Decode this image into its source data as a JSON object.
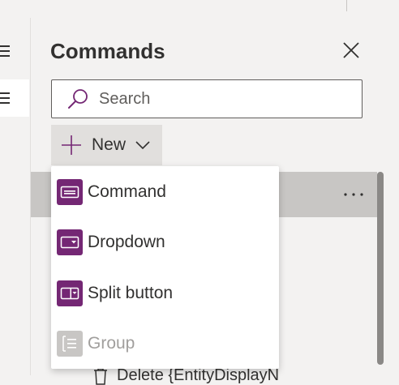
{
  "panel": {
    "title": "Commands",
    "search_placeholder": "Search",
    "new_label": "New",
    "bottom_item_label": "Delete {EntityDisplayN"
  },
  "menu": {
    "items": [
      {
        "label": "Command",
        "icon": "command-icon",
        "disabled": false
      },
      {
        "label": "Dropdown",
        "icon": "dropdown-icon",
        "disabled": false
      },
      {
        "label": "Split button",
        "icon": "split-button-icon",
        "disabled": false
      },
      {
        "label": "Group",
        "icon": "group-icon",
        "disabled": true
      }
    ]
  },
  "colors": {
    "accent": "#742774",
    "panel_bg": "#f3f2f1",
    "selected_row": "#c8c6c4"
  }
}
